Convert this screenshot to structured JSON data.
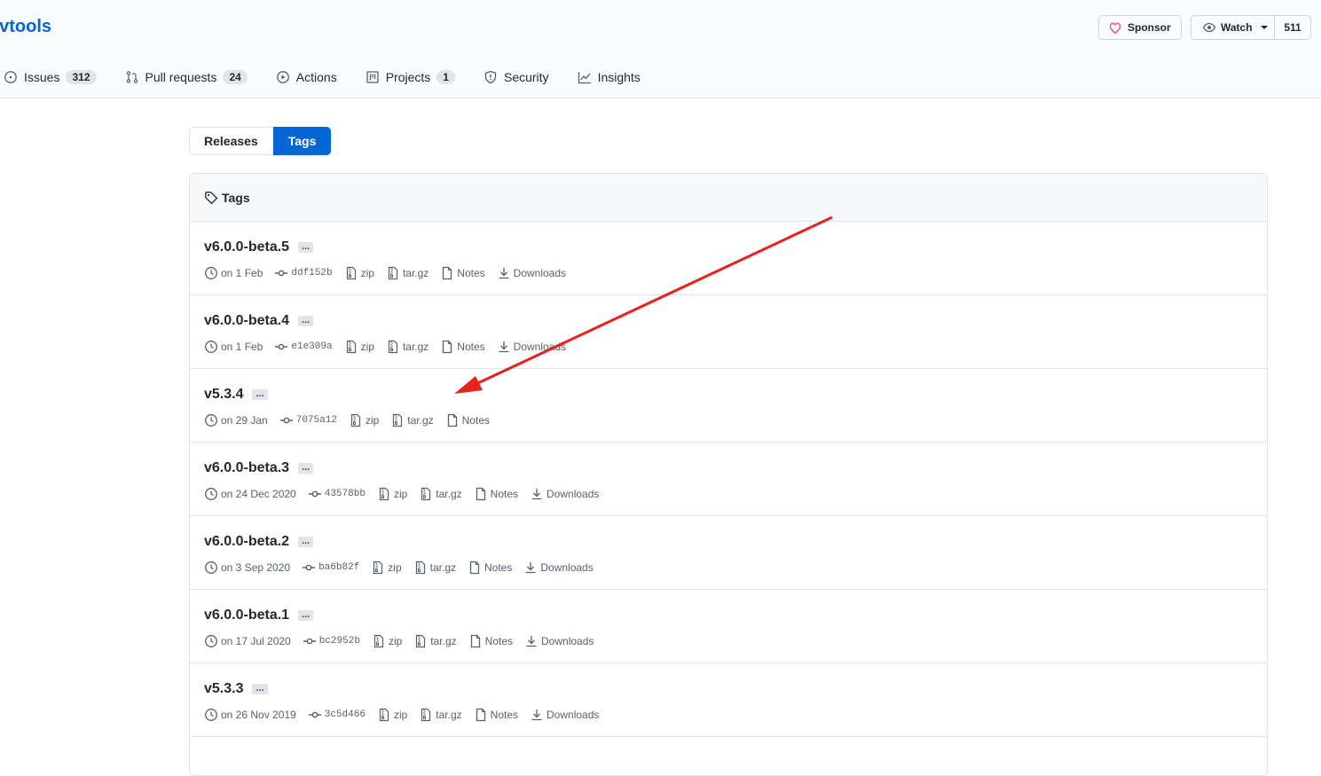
{
  "repo": {
    "name": "evtools"
  },
  "header": {
    "sponsor_label": "Sponsor",
    "watch_label": "Watch",
    "watch_count": "511"
  },
  "nav": [
    {
      "label": "Issues",
      "count": "312",
      "icon": "issue-icon"
    },
    {
      "label": "Pull requests",
      "count": "24",
      "icon": "pull-request-icon"
    },
    {
      "label": "Actions",
      "count": null,
      "icon": "play-icon"
    },
    {
      "label": "Projects",
      "count": "1",
      "icon": "project-icon"
    },
    {
      "label": "Security",
      "count": null,
      "icon": "shield-icon"
    },
    {
      "label": "Insights",
      "count": null,
      "icon": "graph-icon"
    }
  ],
  "subnav": {
    "releases": "Releases",
    "tags": "Tags"
  },
  "box_title": "Tags",
  "labels": {
    "zip": "zip",
    "targz": "tar.gz",
    "notes": "Notes",
    "downloads": "Downloads",
    "ellipsis": "..."
  },
  "tags": [
    {
      "name": "v6.0.0-beta.5",
      "date": "on 1 Feb",
      "sha": "ddf152b",
      "downloads": true
    },
    {
      "name": "v6.0.0-beta.4",
      "date": "on 1 Feb",
      "sha": "e1e309a",
      "downloads": true
    },
    {
      "name": "v5.3.4",
      "date": "on 29 Jan",
      "sha": "7075a12",
      "downloads": false
    },
    {
      "name": "v6.0.0-beta.3",
      "date": "on 24 Dec 2020",
      "sha": "43578bb",
      "downloads": true
    },
    {
      "name": "v6.0.0-beta.2",
      "date": "on 3 Sep 2020",
      "sha": "ba6b82f",
      "downloads": true
    },
    {
      "name": "v6.0.0-beta.1",
      "date": "on 17 Jul 2020",
      "sha": "bc2952b",
      "downloads": true
    },
    {
      "name": "v5.3.3",
      "date": "on 26 Nov 2019",
      "sha": "3c5d466",
      "downloads": true
    }
  ],
  "colors": {
    "accent": "#0366d6",
    "annotation_arrow": "#e8231d"
  }
}
